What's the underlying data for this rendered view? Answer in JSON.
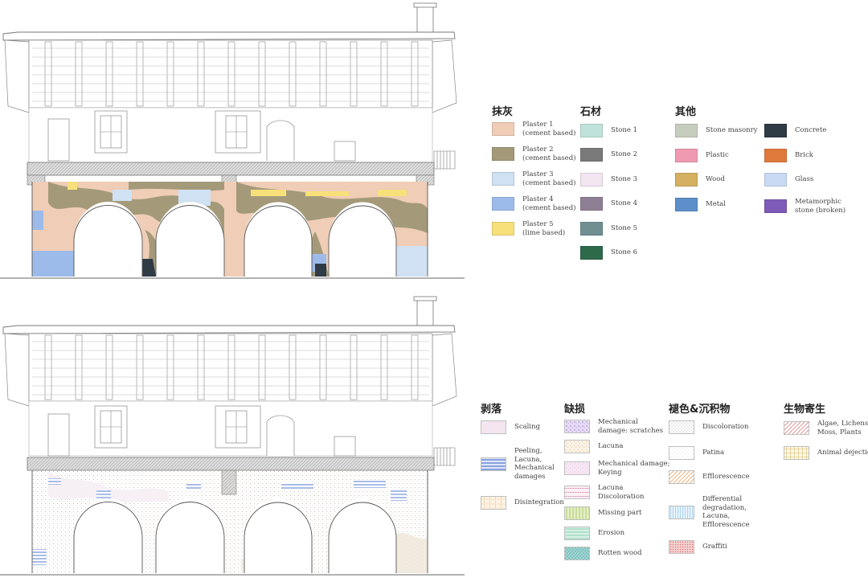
{
  "legend_top": {
    "groups": [
      {
        "title": "抹灰",
        "items": [
          {
            "label": "Plaster 1\n(cement based)",
            "color": "#efcdb6"
          },
          {
            "label": "Plaster 2\n(cement based)",
            "color": "#a49a79"
          },
          {
            "label": "Plaster 3\n(cement based)",
            "color": "#cfe1f3"
          },
          {
            "label": "Plaster 4\n(cement based)",
            "color": "#9dbbea"
          },
          {
            "label": "Plaster 5\n(lime based)",
            "color": "#f7e07a"
          }
        ]
      },
      {
        "title": "石材",
        "items": [
          {
            "label": "Stone 1",
            "color": "#bfe3da"
          },
          {
            "label": "Stone 2",
            "color": "#7a7a7a"
          },
          {
            "label": "Stone 3",
            "color": "#f3e6f2"
          },
          {
            "label": "Stone 4",
            "color": "#8f7f94"
          },
          {
            "label": "Stone 5",
            "color": "#6f8f92"
          },
          {
            "label": "Stone 6",
            "color": "#2d6a4b"
          }
        ]
      },
      {
        "title": "其他",
        "items": [
          {
            "label": "Stone masonry",
            "color": "#c6cdbd"
          },
          {
            "label": "Plastic",
            "color": "#ef9ab0"
          },
          {
            "label": "Wood",
            "color": "#d4b060"
          },
          {
            "label": "Metal",
            "color": "#5d8fca"
          }
        ]
      },
      {
        "title": "",
        "items": [
          {
            "label": "Concrete",
            "color": "#2f3b45"
          },
          {
            "label": "Brick",
            "color": "#e07a3c"
          },
          {
            "label": "Glass",
            "color": "#c9daf4"
          },
          {
            "label": "Metamorphic\nstone (broken)",
            "color": "#7f5bb8"
          }
        ]
      }
    ]
  },
  "legend_bottom": {
    "groups": [
      {
        "title": "剥落",
        "items": [
          {
            "label": "Scaling",
            "pattern": "scaling"
          },
          {
            "label": "Peeling,\nLacuna,\nMechanical\ndamages",
            "pattern": "peeling"
          },
          {
            "label": "Disintegration",
            "pattern": "disintegration"
          }
        ]
      },
      {
        "title": "缺损",
        "items": [
          {
            "label": "Mechanical\ndamage: scratches",
            "pattern": "scratches"
          },
          {
            "label": "Lacuna",
            "pattern": "lacuna"
          },
          {
            "label": "Mechanical damage;\nKeying",
            "pattern": "keying"
          },
          {
            "label": "Lacuna\nDiscoloration",
            "pattern": "lacunadisc"
          },
          {
            "label": "Missing part",
            "pattern": "missing"
          },
          {
            "label": "Erosion",
            "pattern": "erosion"
          },
          {
            "label": "Rotten wood",
            "pattern": "rotten"
          }
        ]
      },
      {
        "title": "褪色&沉积物",
        "items": [
          {
            "label": "Discoloration",
            "pattern": "discoloration"
          },
          {
            "label": "Patina",
            "pattern": "patina"
          },
          {
            "label": "Efflorescence",
            "pattern": "efflorescence"
          },
          {
            "label": "Differential\ndegradation,\nLacuna,\nEfflorescence",
            "pattern": "differential"
          },
          {
            "label": "Graffiti",
            "pattern": "graffiti"
          }
        ]
      },
      {
        "title": "生物寄生",
        "items": [
          {
            "label": "Algae, Lichens,\nMoss, Plants",
            "pattern": "algae"
          },
          {
            "label": "Animal dejections",
            "pattern": "animal"
          }
        ]
      }
    ]
  }
}
